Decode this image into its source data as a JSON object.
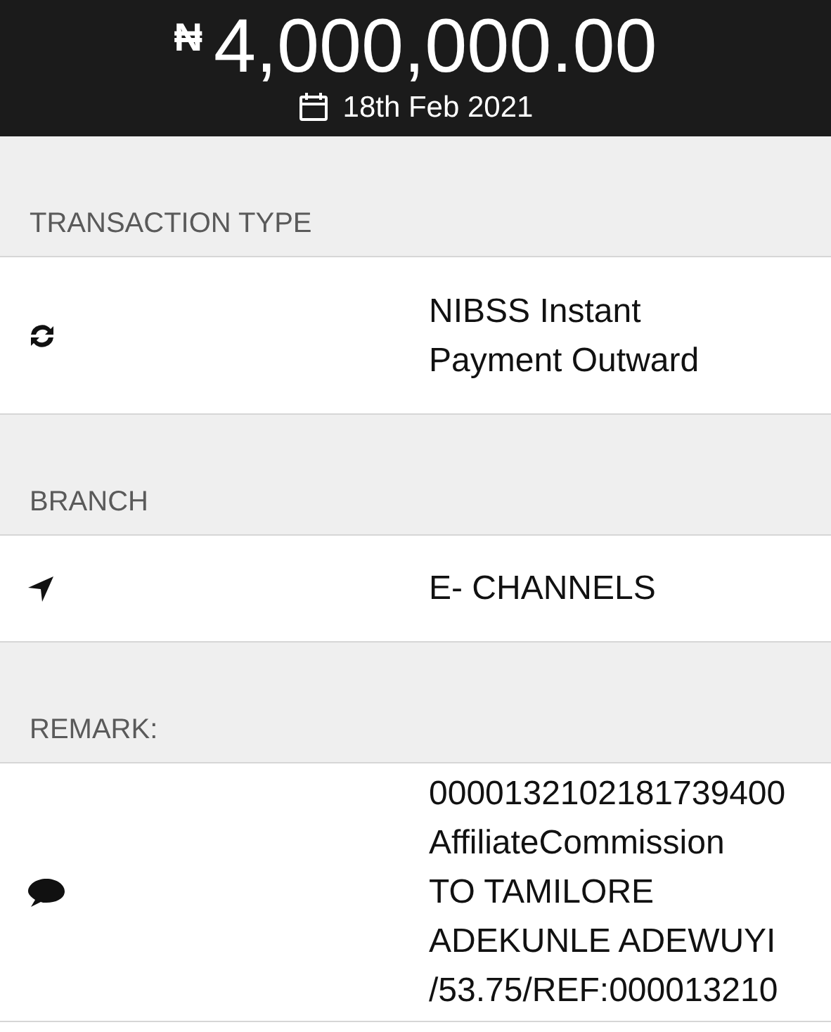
{
  "header": {
    "currency": "₦",
    "amount": "4,000,000.00",
    "date": "18th Feb 2021"
  },
  "sections": [
    {
      "label": "TRANSACTION TYPE",
      "kind": "refresh",
      "lines": [
        "NIBSS Instant",
        "Payment Outward"
      ]
    },
    {
      "label": "BRANCH",
      "kind": "location",
      "lines": [
        "E- CHANNELS"
      ]
    },
    {
      "label": "REMARK:",
      "kind": "comment",
      "lines": [
        "0000132102181739400",
        "AffiliateCommission",
        "TO TAMILORE",
        "ADEKUNLE ADEWUYI",
        "/53.75/REF:000013210"
      ]
    }
  ]
}
